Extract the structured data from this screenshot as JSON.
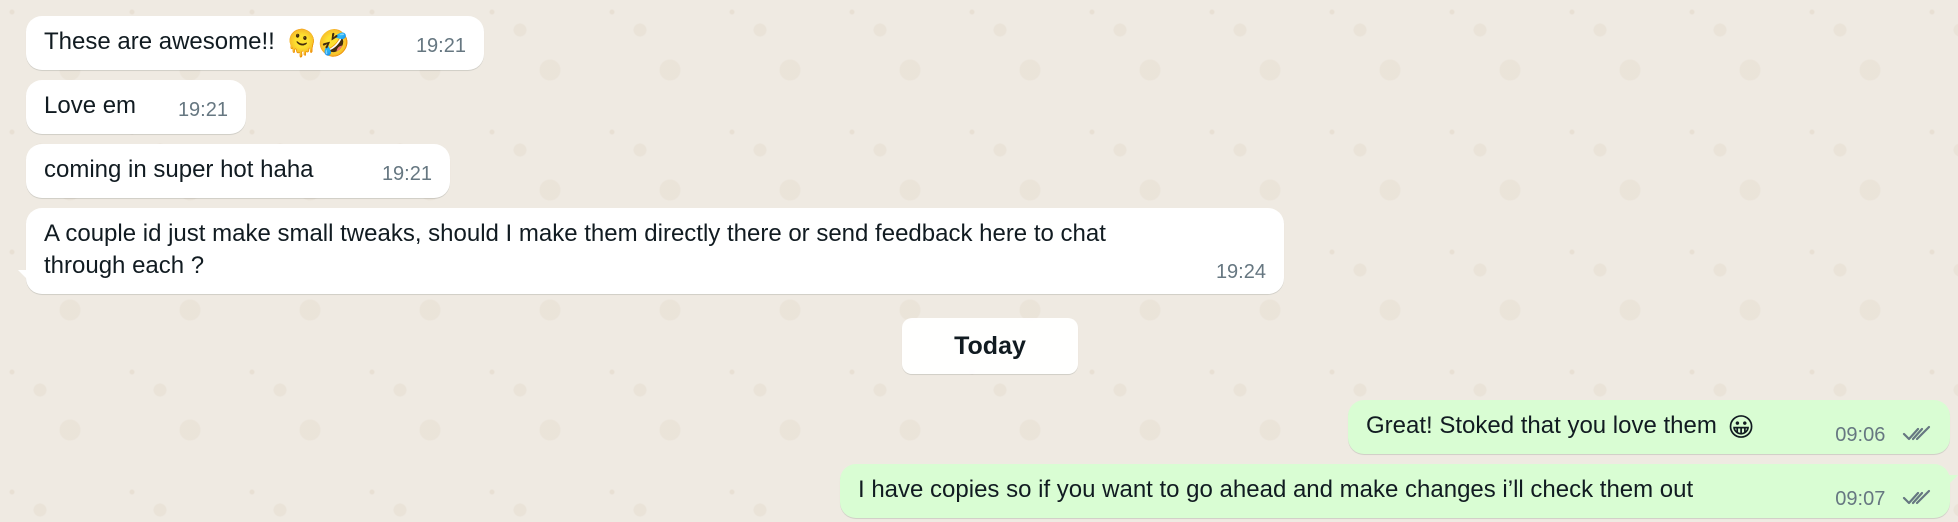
{
  "conversation": {
    "incoming_messages": [
      {
        "text": "These are awesome!!",
        "emoji": "🫠🤣",
        "time": "19:21"
      },
      {
        "text": "Love em",
        "time": "19:21"
      },
      {
        "text": "coming in super hot haha",
        "time": "19:21"
      },
      {
        "text_line1": "A couple id just make small tweaks, should I make them directly there or send feedback here to chat",
        "text_line2": "through each ?",
        "time": "19:24"
      }
    ],
    "date_divider": "Today",
    "outgoing_messages": [
      {
        "text": "Great! Stoked that you love them",
        "emoji": "😀",
        "time": "09:06",
        "status_icon": "double-check-icon"
      },
      {
        "text": "I have copies so if you want to go ahead and make changes i’ll check them out",
        "time": "09:07",
        "status_icon": "double-check-icon"
      }
    ]
  },
  "theme": {
    "background": "#efeae2",
    "incoming_bubble": "#ffffff",
    "outgoing_bubble": "#d9fdd3",
    "meta_text": "#667781",
    "primary_text": "#111b21"
  }
}
